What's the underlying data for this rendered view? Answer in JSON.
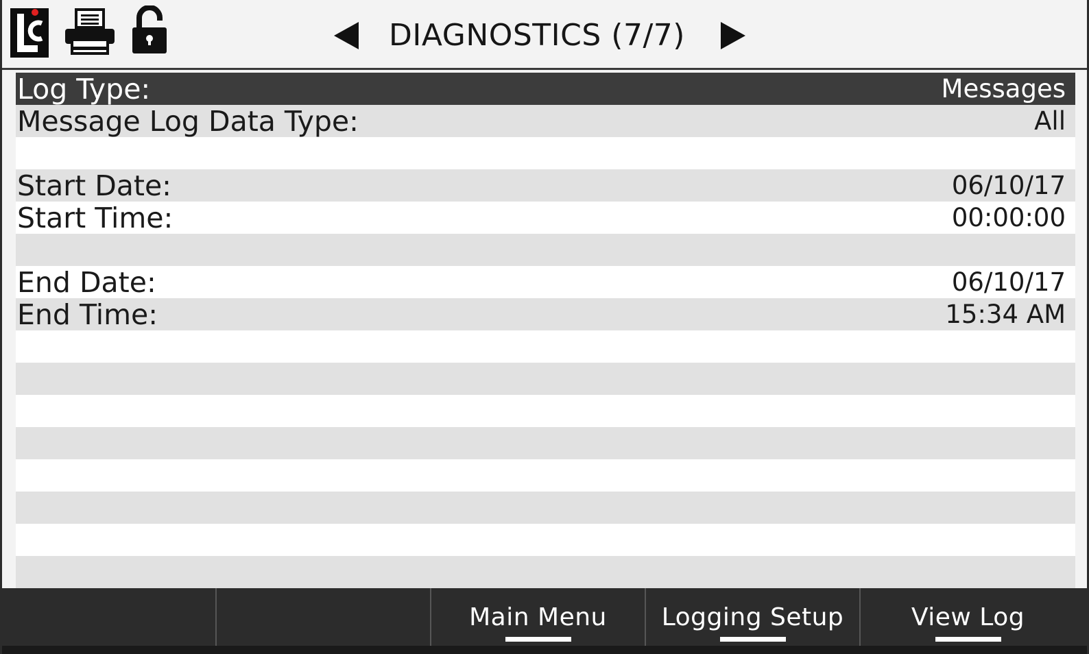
{
  "header": {
    "title": "DIAGNOSTICS (7/7)",
    "logo_icon": "lc-logo",
    "logo_letters": "LC",
    "icons": [
      "printer-icon",
      "unlock-icon"
    ],
    "prev_icon": "triangle-left-icon",
    "next_icon": "triangle-right-icon"
  },
  "rows": [
    {
      "label": "Log Type:",
      "value": "Messages",
      "selected": true
    },
    {
      "label": "Message Log Data Type:",
      "value": "All"
    },
    {
      "label": "",
      "value": ""
    },
    {
      "label": "Start Date:",
      "value": "06/10/17"
    },
    {
      "label": "Start Time:",
      "value": "00:00:00"
    },
    {
      "label": "",
      "value": ""
    },
    {
      "label": "End Date:",
      "value": "06/10/17"
    },
    {
      "label": "End Time:",
      "value": "15:34 AM"
    },
    {
      "label": "",
      "value": ""
    },
    {
      "label": "",
      "value": ""
    },
    {
      "label": "",
      "value": ""
    },
    {
      "label": "",
      "value": ""
    },
    {
      "label": "",
      "value": ""
    },
    {
      "label": "",
      "value": ""
    },
    {
      "label": "",
      "value": ""
    },
    {
      "label": "",
      "value": ""
    }
  ],
  "footer": {
    "softkeys": [
      "",
      "",
      "Main Menu",
      "Logging Setup",
      "View Log"
    ]
  },
  "colors": {
    "selected_row": "#3c3c3c",
    "stripe_dark": "#e1e1e1",
    "stripe_light": "#ffffff",
    "footer_bg": "#2c2c2c",
    "logo_dot": "#e02020"
  }
}
